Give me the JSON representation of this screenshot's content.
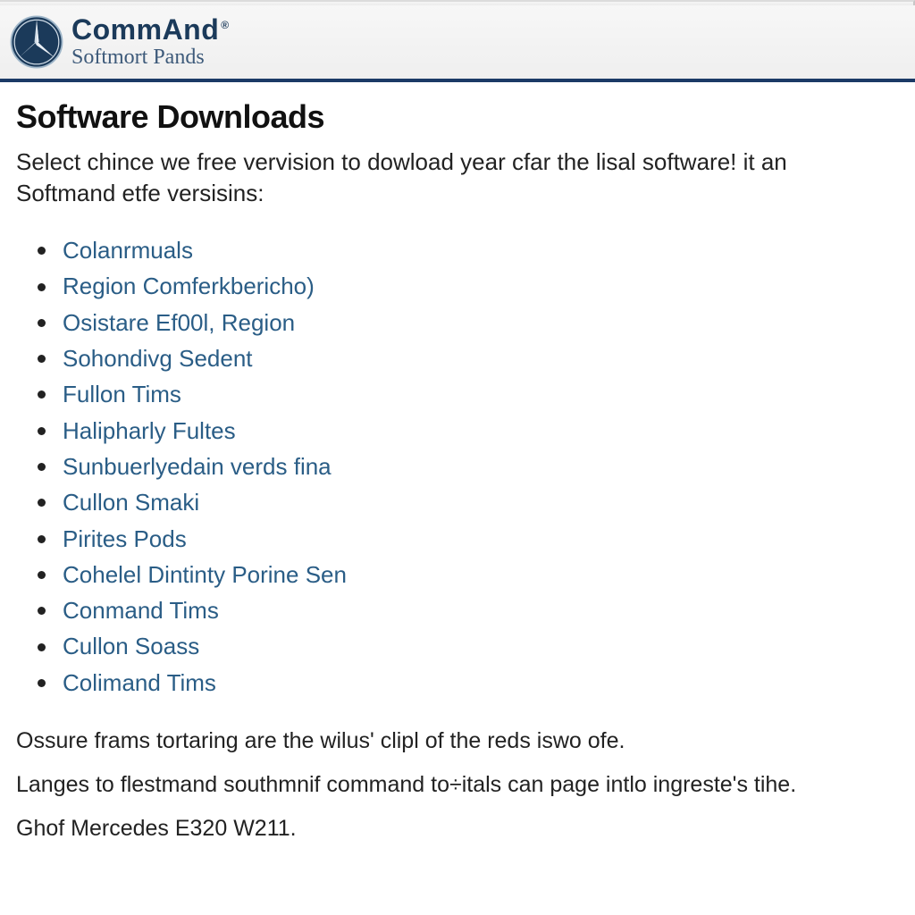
{
  "header": {
    "brand_title": "CommAnd",
    "brand_reg": "®",
    "brand_sub": "Softmort Pands"
  },
  "page": {
    "title": "Software Downloads",
    "intro": "Select chince we free vervision to dowload year cfar the lisal software! it an Softmand etfe versisins:"
  },
  "links": [
    "Colanrmuals",
    "Region Comferkbericho)",
    "Osistare Ef00l, Region",
    "Sohondivg Sedent",
    "Fullon Tims",
    "Halipharly Fultes",
    "Sunbuerlyedain verds fina",
    "Cullon Smaki",
    "Pirites Pods",
    "Cohelel Dintinty Porine Sen",
    "Conmand Tims",
    "Cullon Soass",
    "Colimand Tims"
  ],
  "footer": {
    "p1": "Ossure frams tortaring are the wilus' clipl of the reds iswo ofe.",
    "p2": "Langes to flestmand southmnif command to÷itals can page intlo ingreste's tihe.",
    "p3": "Ghof Mercedes E320 W211."
  }
}
